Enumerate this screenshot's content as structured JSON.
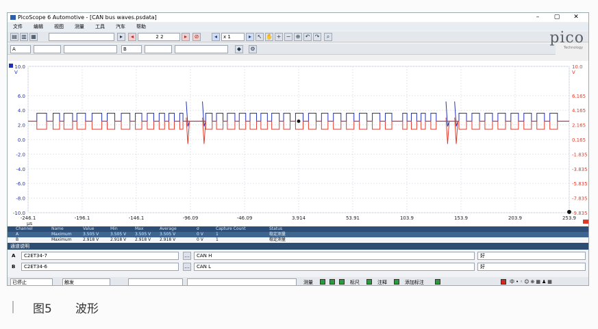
{
  "window": {
    "title": "PicoScope 6 Automotive - [CAN bus waves.psdata]",
    "min": "–",
    "max": "▢",
    "close": "✕"
  },
  "menu": [
    "文件",
    "编辑",
    "视图",
    "测量",
    "工具",
    "汽车",
    "帮助"
  ],
  "toolbar": {
    "buffer_value": "2 2",
    "zoom_value": "x 1",
    "nav_prev": "◂",
    "nav_next": "▸",
    "stop": "⊘"
  },
  "logo": {
    "text": "pico",
    "sub": "Technology"
  },
  "chart_data": {
    "type": "line",
    "y_left_ticks": [
      "10.0",
      "6.0",
      "4.0",
      "2.0",
      "0.0",
      "-2.0",
      "-4.0",
      "-6.0",
      "-8.0",
      "-10.0"
    ],
    "y_left_unit": "V",
    "y_right_ticks": [
      "10.0",
      "6.165",
      "4.165",
      "2.165",
      "0.165",
      "-1.835",
      "-3.835",
      "-5.835",
      "-7.835",
      "-9.835"
    ],
    "y_right_unit": "V",
    "x_ticks": [
      "-246.1",
      "-196.1",
      "-146.1",
      "-96.09",
      "-46.09",
      "3.914",
      "53.91",
      "103.9",
      "153.9",
      "203.9",
      "253.9"
    ],
    "x_unit": "μs",
    "ylim": [
      -10,
      10
    ],
    "xlim": [
      -246.1,
      253.9
    ],
    "series": [
      {
        "name": "CAN H",
        "color": "#1f2fb8",
        "recessive": 2.5,
        "dominant": 3.6
      },
      {
        "name": "CAN L",
        "color": "#e23a2a",
        "recessive": 2.5,
        "dominant": 1.4
      }
    ],
    "pulses": [
      [
        -238,
        -229
      ],
      [
        -223,
        -217
      ],
      [
        -213,
        -205
      ],
      [
        -201,
        -193
      ],
      [
        -187,
        -178
      ],
      [
        -173,
        -166
      ],
      [
        -160,
        -152
      ],
      [
        -147,
        -141
      ],
      [
        -136,
        -130
      ],
      [
        -125,
        -120
      ],
      [
        -116,
        -111
      ],
      [
        -106,
        -103
      ],
      [
        -82,
        -76
      ],
      [
        -72,
        -66
      ],
      [
        -62,
        -55
      ],
      [
        -51,
        -45
      ],
      [
        -41,
        -35
      ],
      [
        -31,
        -25
      ],
      [
        -21,
        -14
      ],
      [
        -10,
        -4
      ],
      [
        1,
        8
      ],
      [
        13,
        20
      ],
      [
        25,
        31
      ],
      [
        36,
        43
      ],
      [
        48,
        55
      ],
      [
        60,
        67
      ],
      [
        72,
        79
      ],
      [
        84,
        90
      ],
      [
        100,
        104
      ],
      [
        108,
        113
      ],
      [
        117,
        121
      ],
      [
        126,
        131
      ],
      [
        152,
        159
      ],
      [
        164,
        171
      ],
      [
        176,
        183
      ],
      [
        188,
        195
      ],
      [
        200,
        207
      ],
      [
        212,
        219
      ],
      [
        224,
        231
      ],
      [
        236,
        243
      ]
    ],
    "spikes": [
      -100,
      -85,
      140,
      148
    ]
  },
  "table": {
    "headers": [
      "Channel",
      "Name",
      "Value",
      "Min",
      "Max",
      "Average",
      "σ",
      "Capture Count",
      "Status"
    ],
    "rows": [
      [
        "A",
        "Maximum",
        "3.505 V",
        "3.505 V",
        "3.505 V",
        "3.505 V",
        "0 V",
        "1",
        "稳定测量"
      ],
      [
        "B",
        "Maximum",
        "2.918 V",
        "2.918 V",
        "2.918 V",
        "2.918 V",
        "0 V",
        "1",
        "稳定测量"
      ]
    ]
  },
  "channels": {
    "title": "通道说明",
    "a": {
      "label": "A",
      "probe": "C2ET34-7",
      "name": "CAN H",
      "status": "好"
    },
    "b": {
      "label": "B",
      "probe": "C2ET34-6",
      "name": "CAN L",
      "status": "好"
    }
  },
  "status": {
    "trigger": "已停止",
    "mode": "触发",
    "label_a": "测量",
    "label_b": "标尺",
    "label_c": "注释",
    "label_d": "添加标注"
  },
  "caption": {
    "figure": "图5",
    "text": "波形"
  }
}
